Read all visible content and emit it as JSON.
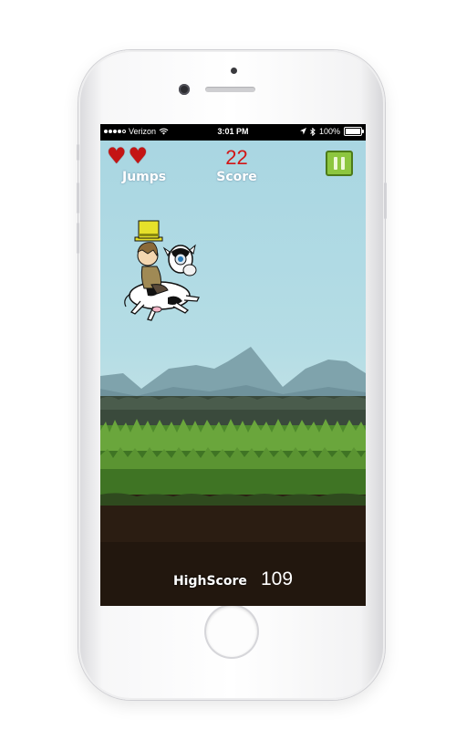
{
  "status_bar": {
    "carrier": "Verizon",
    "time": "3:01 PM",
    "battery_percent": "100%",
    "battery_level": 1.0,
    "signal_bars_filled": 4,
    "signal_bars_total": 5,
    "icons": [
      "wifi-icon",
      "location-arrow-icon",
      "bluetooth-icon",
      "battery-icon"
    ]
  },
  "hud": {
    "lives": 2,
    "jumps_label": "Jumps",
    "score_value": "22",
    "score_label": "Score",
    "pause_icon": "pause-icon"
  },
  "footer": {
    "highscore_label": "HighScore",
    "highscore_value": "109"
  },
  "colors": {
    "sky": "#a9d6e2",
    "score_red": "#d21515",
    "heart_red": "#c41414",
    "pause_green": "#8dc63f",
    "mountain": "#7fa3ac",
    "grass": "#4e8a2c",
    "dirt": "#2b1d12"
  }
}
